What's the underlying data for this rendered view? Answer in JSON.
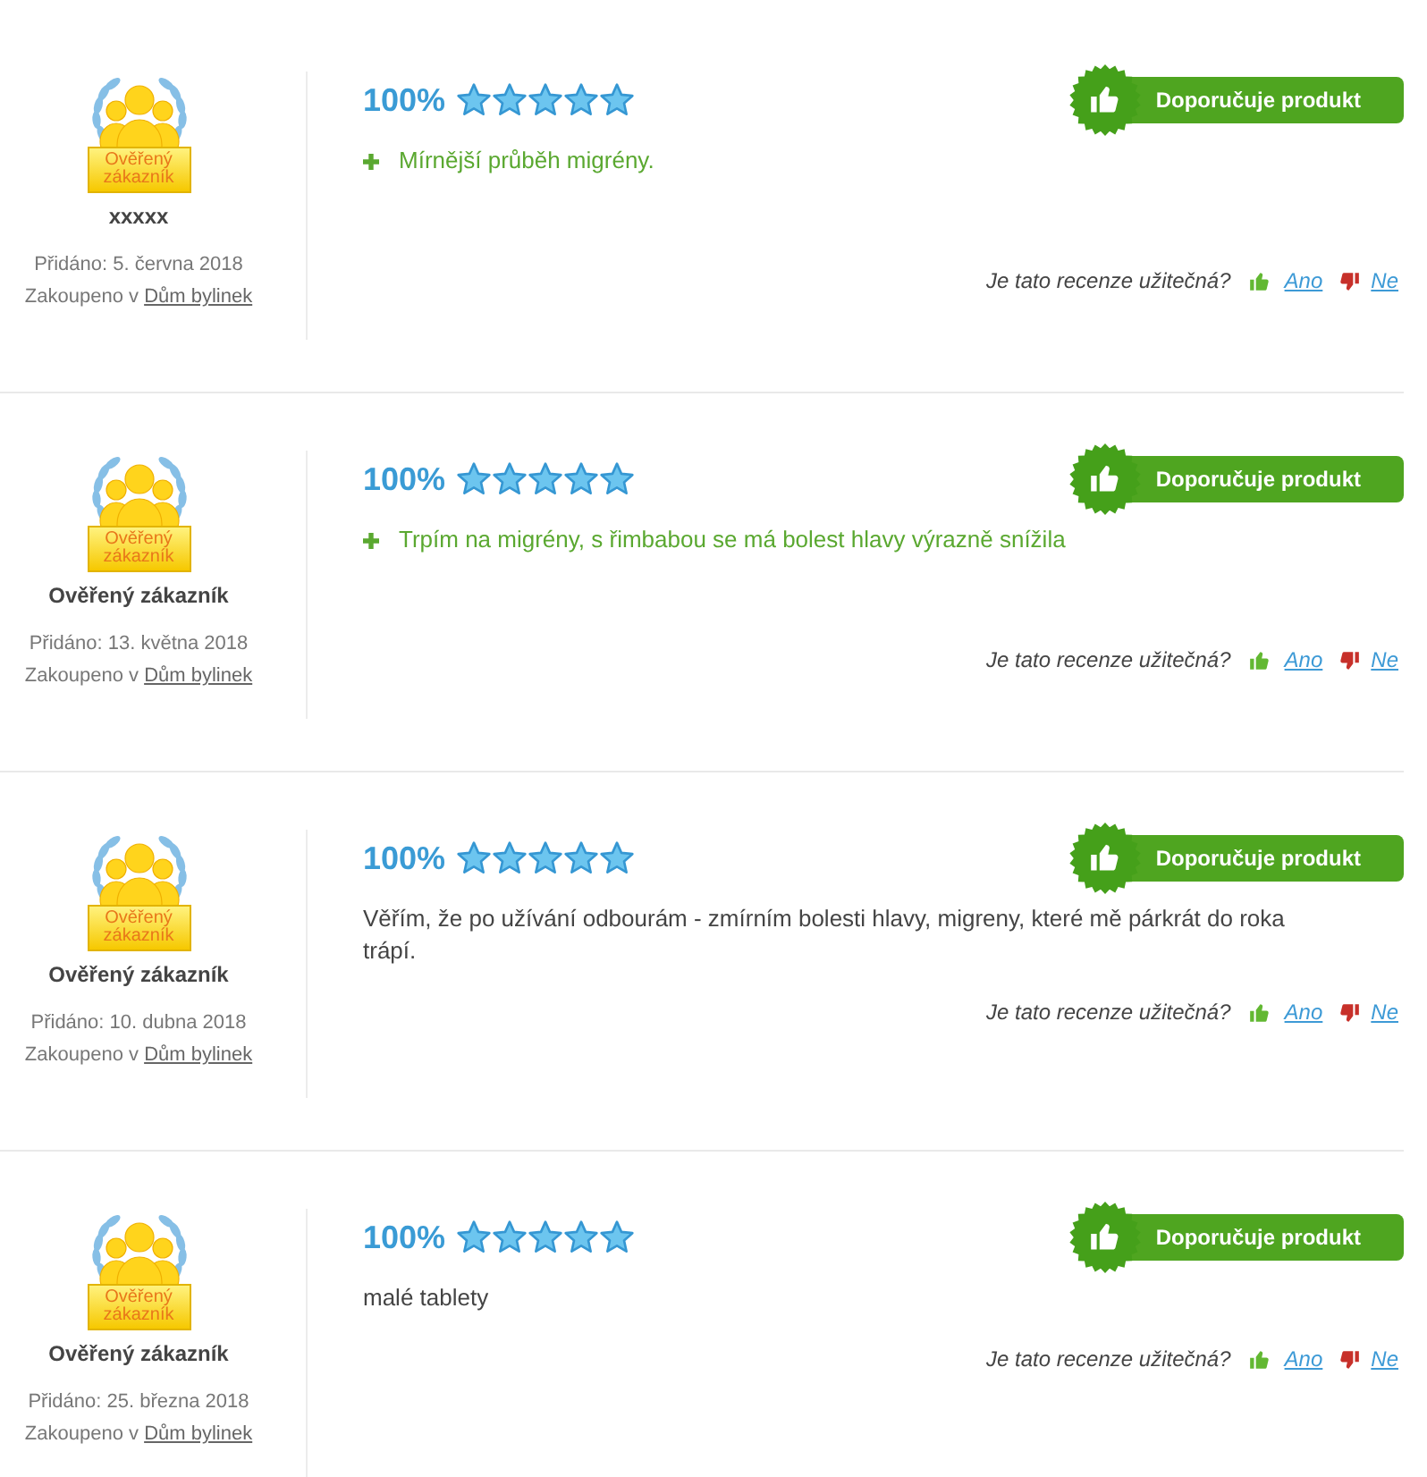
{
  "reviews": [
    {
      "author": "xxxxx",
      "badge": "Ověřený zákazník",
      "added": "Přidáno: 5. června 2018",
      "purchased": "Zakoupeno v",
      "shop": "Dům bylinek",
      "rating": "100%",
      "stars": 5,
      "recommend": "Doporučuje produkt",
      "comments": [
        {
          "kind": "pro",
          "text": "Mírnější průběh migrény."
        }
      ],
      "helpful": {
        "question": "Je tato recenze užitečná?",
        "yes": "Ano",
        "no": "Ne"
      }
    },
    {
      "author": "Ověřený zákazník",
      "badge": "Ověřený zákazník",
      "added": "Přidáno: 13. května 2018",
      "purchased": "Zakoupeno v",
      "shop": "Dům bylinek",
      "rating": "100%",
      "stars": 5,
      "recommend": "Doporučuje produkt",
      "comments": [
        {
          "kind": "pro",
          "text": "Trpím na migrény, s řimbabou se má bolest hlavy výrazně snížila"
        }
      ],
      "helpful": {
        "question": "Je tato recenze užitečná?",
        "yes": "Ano",
        "no": "Ne"
      }
    },
    {
      "author": "Ověřený zákazník",
      "badge": "Ověřený zákazník",
      "added": "Přidáno: 10. dubna 2018",
      "purchased": "Zakoupeno v",
      "shop": "Dům bylinek",
      "rating": "100%",
      "stars": 5,
      "recommend": "Doporučuje produkt",
      "comments": [
        {
          "kind": "text",
          "text": "Věřím, že po užívání odbourám - zmírním bolesti hlavy, migreny, které mě párkrát do roka trápí."
        }
      ],
      "helpful": {
        "question": "Je tato recenze užitečná?",
        "yes": "Ano",
        "no": "Ne"
      }
    },
    {
      "author": "Ověřený zákazník",
      "badge": "Ověřený zákazník",
      "added": "Přidáno: 25. března 2018",
      "purchased": "Zakoupeno v",
      "shop": "Dům bylinek",
      "rating": "100%",
      "stars": 5,
      "recommend": "Doporučuje produkt",
      "comments": [
        {
          "kind": "text",
          "text": "malé tablety"
        }
      ],
      "helpful": {
        "question": "Je tato recenze užitečná?",
        "yes": "Ano",
        "no": "Ne"
      }
    }
  ]
}
